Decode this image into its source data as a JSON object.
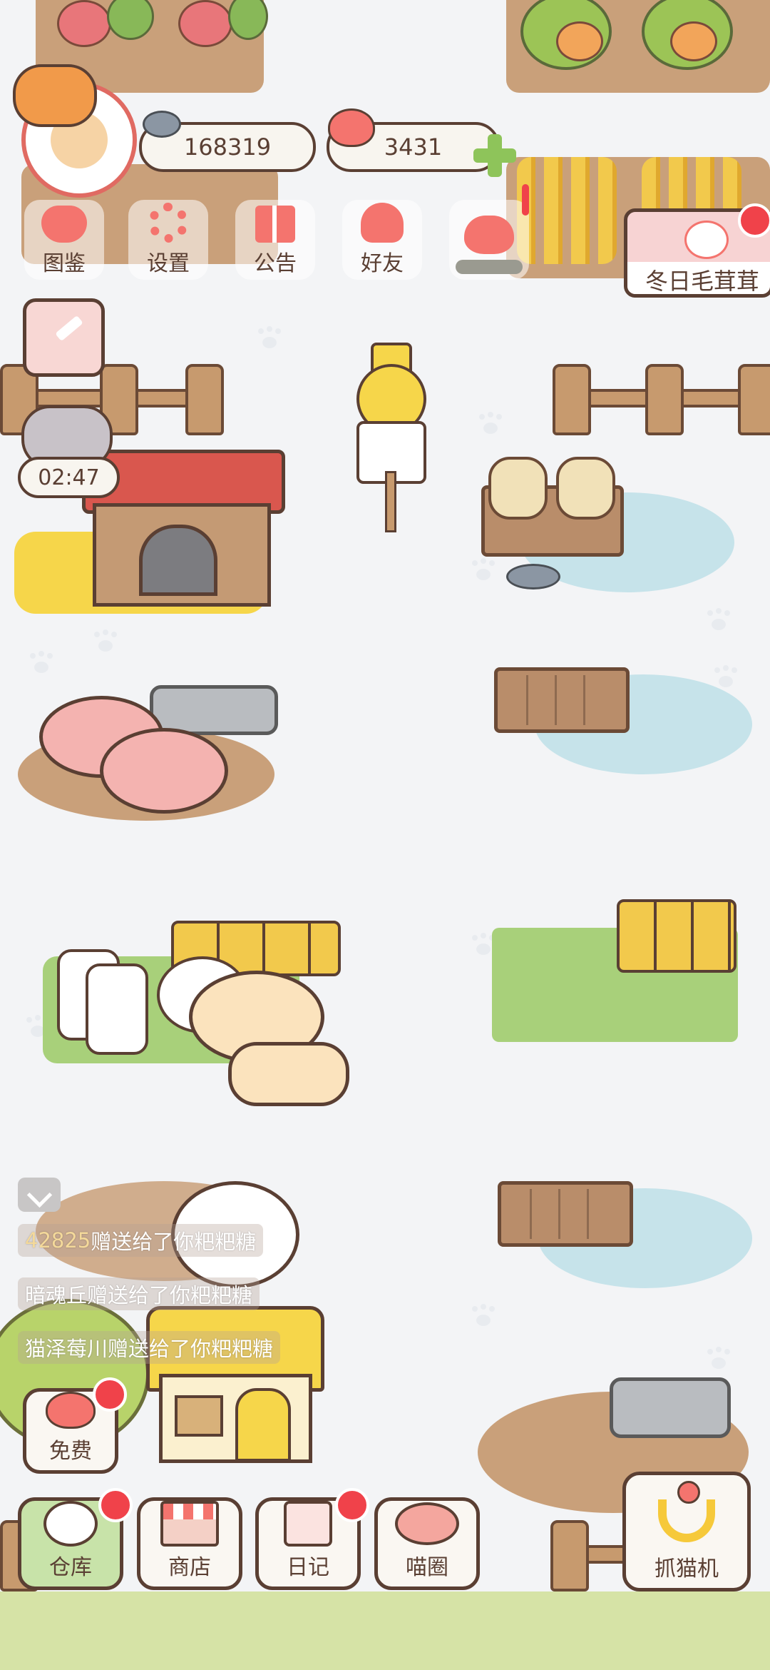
{
  "hud": {
    "fish_count": "168319",
    "heart_count": "3431",
    "timer": "02:47"
  },
  "top_menu": [
    {
      "label": "图鉴",
      "icon": "cat-head-icon"
    },
    {
      "label": "设置",
      "icon": "gear-icon"
    },
    {
      "label": "公告",
      "icon": "gift-icon"
    },
    {
      "label": "好友",
      "icon": "friends-icon"
    },
    {
      "label": "",
      "icon": "hearts-icon"
    }
  ],
  "event_banner": {
    "label": "冬日毛茸茸"
  },
  "chat_feed": [
    {
      "prefix": "42825",
      "text": "赠送给了你粑粑糖"
    },
    {
      "prefix": "",
      "text": "暗魂丘赠送给了你粑粑糖"
    },
    {
      "prefix": "",
      "text": "猫泽莓川赠送给了你粑粑糖"
    }
  ],
  "free_button": {
    "label": "免费"
  },
  "bottom_nav": [
    {
      "label": "仓库",
      "icon": "bowl-icon"
    },
    {
      "label": "商店",
      "icon": "shop-icon"
    },
    {
      "label": "日记",
      "icon": "diary-icon"
    },
    {
      "label": "喵圈",
      "icon": "cat-planet-icon"
    }
  ],
  "claw_machine": {
    "label": "抓猫机"
  },
  "colors": {
    "outline": "#5a3f33",
    "badge": "#f0424a",
    "grass": "#a8d07a",
    "active_tab": "#c8e3a9"
  }
}
